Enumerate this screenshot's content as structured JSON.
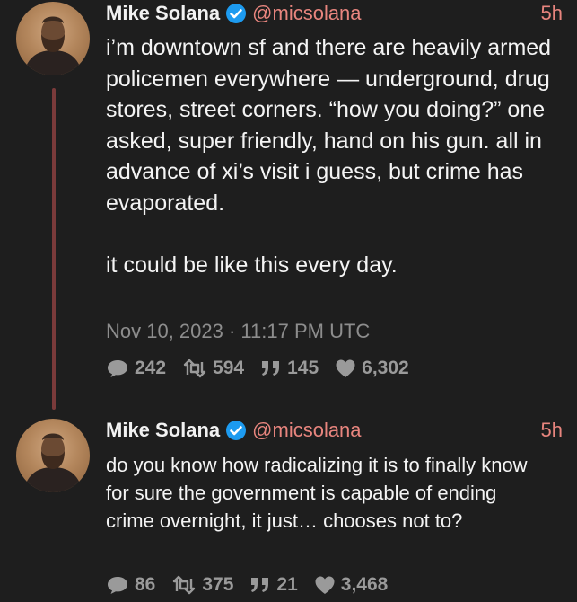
{
  "tweets": [
    {
      "author_name": "Mike Solana",
      "handle": "@micsolana",
      "time": "5h",
      "text": "i’m downtown sf and there are heavily armed policemen everywhere — underground, drug stores, street corners. “how you doing?” one asked, super friendly, hand on his gun. all in advance of xi’s visit i guess, but crime has evaporated.\n\nit could be like this every day.",
      "date": "Nov 10, 2023 · 11:17 PM UTC",
      "replies": "242",
      "retweets": "594",
      "quotes": "145",
      "likes": "6,302"
    },
    {
      "author_name": "Mike Solana",
      "handle": "@micsolana",
      "time": "5h",
      "text": "do you know how radicalizing it is to finally know for sure the government is capable of ending crime overnight, it just… chooses not to?",
      "replies": "86",
      "retweets": "375",
      "quotes": "21",
      "likes": "3,468"
    }
  ],
  "colors": {
    "background": "#1e1e1e",
    "accent": "#e8857e",
    "thread_line": "#7a3a3a",
    "verified": "#1d9bf0",
    "muted": "#9a9a9a"
  },
  "icons": [
    "verified-icon",
    "reply-icon",
    "retweet-icon",
    "quote-icon",
    "heart-icon"
  ]
}
